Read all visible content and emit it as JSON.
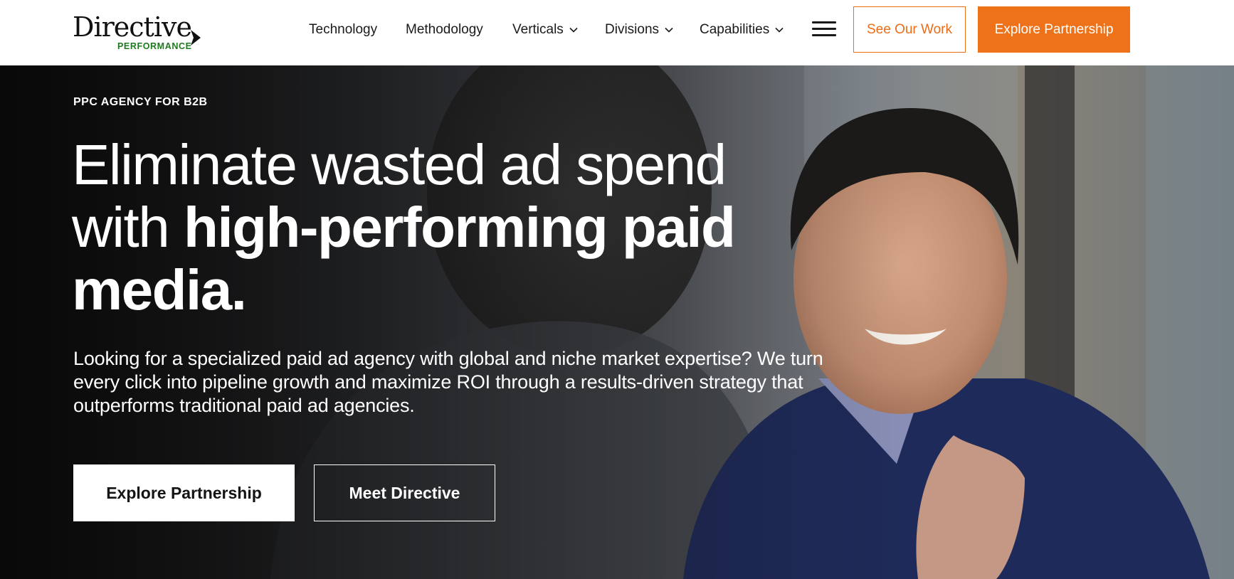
{
  "brand": {
    "name": "Directive",
    "sub": "PERFORMANCE",
    "accent_color": "#ee7219",
    "sub_color": "#1f7a1f"
  },
  "nav": {
    "items": [
      {
        "label": "Technology",
        "has_dropdown": false
      },
      {
        "label": "Methodology",
        "has_dropdown": false
      },
      {
        "label": "Verticals",
        "has_dropdown": true
      },
      {
        "label": "Divisions",
        "has_dropdown": true
      },
      {
        "label": "Capabilities",
        "has_dropdown": true
      }
    ],
    "menu_icon": "hamburger-menu-icon",
    "secondary_cta": "See Our Work",
    "primary_cta": "Explore Partnership"
  },
  "hero": {
    "eyebrow": "PPC AGENCY FOR B2B",
    "headline_regular": "Eliminate wasted ad spend with ",
    "headline_bold": "high-performing paid media.",
    "body": "Looking for a specialized paid ad agency with global and niche market expertise? We turn every click into pipeline growth and maximize ROI through a results-driven strategy that outperforms traditional paid ad agencies.",
    "primary_cta": "Explore Partnership",
    "secondary_cta": "Meet Directive",
    "background": "photo of two men talking outdoors"
  }
}
